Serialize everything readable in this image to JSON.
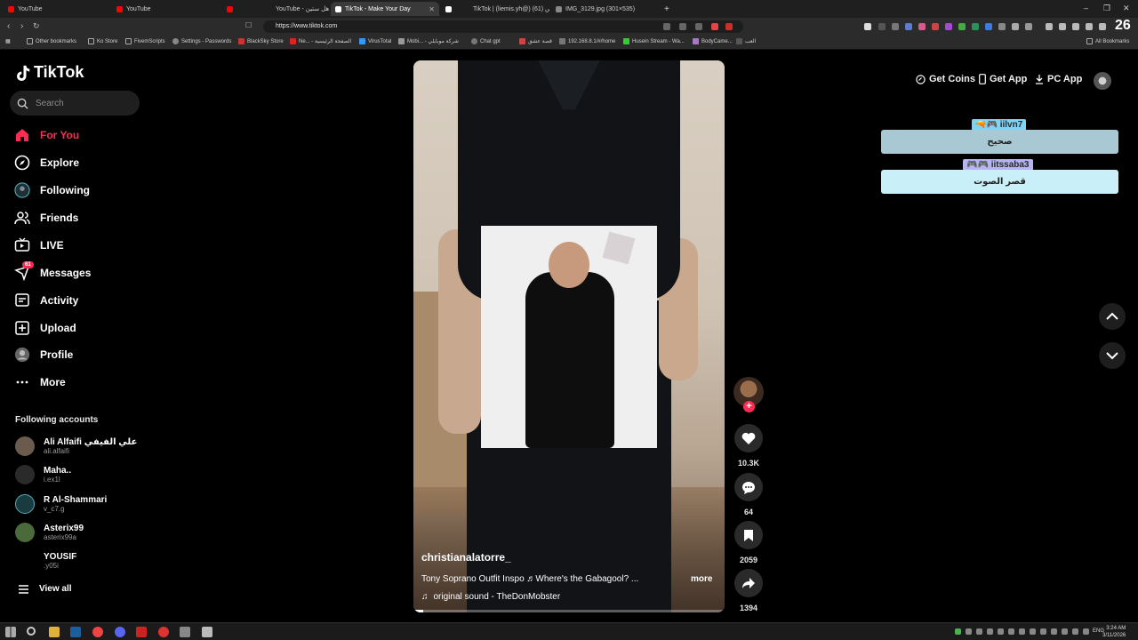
{
  "browser": {
    "tabs": [
      {
        "title": "YouTube",
        "fav": "#ff0000"
      },
      {
        "title": "YouTube",
        "fav": "#ff0000"
      },
      {
        "title": "YouTube - باهل ستين",
        "fav": "#ff0000"
      },
      {
        "title": "TikTok - Make Your Day",
        "fav": "#ffffff",
        "active": true
      },
      {
        "title": "TikTok | (liemis.yh@) الخميس (61)",
        "fav": "#ffffff"
      },
      {
        "title": "IMG_3129.jpg (301×535)",
        "fav": "#888888"
      }
    ],
    "new_tab": "+",
    "url": "https://www.tiktok.com",
    "bookmarks": [
      "Other bookmarks",
      "Ko Store",
      "FivemScripts",
      "Settings - Passwords",
      "BlackSky Store",
      "Ne... - الصفحة الرئيسية",
      "VirusTotal",
      "Mobi... - شركة موبايلي",
      "Chat gpt",
      "قصة عشق",
      "192.168.8.1/#/home",
      "Husein Stream - Wa...",
      "BodyCame...",
      "العب"
    ],
    "all_bookmarks": "All Bookmarks",
    "corner_badge": "26"
  },
  "sidebar": {
    "logo": "TikTok",
    "search_placeholder": "Search",
    "nav": [
      {
        "label": "For You",
        "icon": "home-icon",
        "active": true
      },
      {
        "label": "Explore",
        "icon": "compass-icon"
      },
      {
        "label": "Following",
        "icon": "following-avatar-icon"
      },
      {
        "label": "Friends",
        "icon": "friends-icon"
      },
      {
        "label": "LIVE",
        "icon": "live-tv-icon"
      },
      {
        "label": "Messages",
        "icon": "messages-icon",
        "badge": "61"
      },
      {
        "label": "Activity",
        "icon": "activity-icon"
      },
      {
        "label": "Upload",
        "icon": "upload-icon"
      },
      {
        "label": "Profile",
        "icon": "profile-avatar-icon"
      },
      {
        "label": "More",
        "icon": "more-icon"
      }
    ],
    "following_title": "Following accounts",
    "accounts": [
      {
        "name": "Ali Alfaifi علي الفيفي",
        "handle": "ali.alfaifi",
        "color": "#6b5a4e"
      },
      {
        "name": "Maha..",
        "handle": "i.ex1l",
        "color": "#2a2a2a"
      },
      {
        "name": "R Al-Shammari",
        "handle": "v_c7.g",
        "color": "#1a3b3e"
      },
      {
        "name": "Asterix99",
        "handle": "asterix99a",
        "color": "#4a6a3a"
      },
      {
        "name": "YOUSIF",
        "handle": ".y05i",
        "color": "#000000"
      }
    ],
    "view_all": "View all"
  },
  "video": {
    "username": "christianalatorre_",
    "description": "Tony Soprano Outfit Inspo ♬Where's the Gabagool? ...",
    "more": "more",
    "sound": "original sound - TheDonMobster",
    "progress": 0.03
  },
  "actions": {
    "likes": "10.3K",
    "comments": "64",
    "saves": "2059",
    "shares": "1394"
  },
  "topbar": {
    "get_coins": "Get Coins",
    "get_app": "Get App",
    "pc_app": "PC App"
  },
  "overlay": {
    "tag1": "iilvn7",
    "bubble1": "صحيح",
    "tag2": "iitssaba3",
    "bubble2": "قصر الصوت"
  },
  "taskbar": {
    "lang": "ENG",
    "time": "3:24 AM",
    "date": "3/11/2026"
  },
  "colors": {
    "accent": "#fe2c55",
    "bubble1": "#a8c9d3",
    "bubble2": "#c9eff8"
  }
}
